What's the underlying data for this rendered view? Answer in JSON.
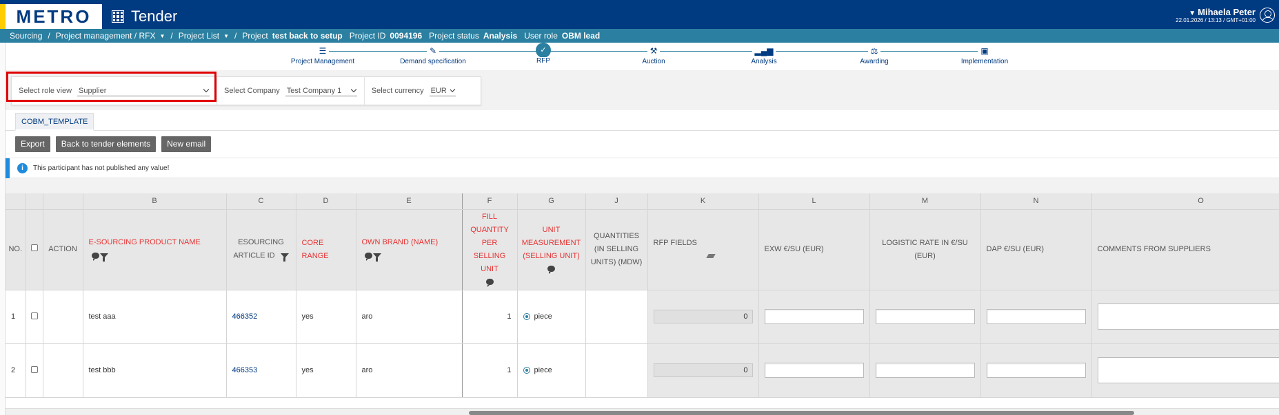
{
  "header": {
    "logo": "METRO",
    "app_title": "Tender",
    "user_name": "Mihaela Peter",
    "user_datetime": "22.01.2026 / 13:13 / GMT+01:00"
  },
  "breadcrumb": {
    "sourcing": "Sourcing",
    "project_management": "Project management / RFX",
    "project_list": "Project List",
    "project_label": "Project",
    "project_name": "test back to setup",
    "project_id_label": "Project ID",
    "project_id": "0094196",
    "status_label": "Project status",
    "status": "Analysis",
    "role_label": "User role",
    "role": "OBM lead"
  },
  "stepper": {
    "steps": [
      {
        "label": "Project Management",
        "icon": "list-icon"
      },
      {
        "label": "Demand specification",
        "icon": "pen-icon"
      },
      {
        "label": "RFP",
        "icon": "rfp-icon",
        "active": true
      },
      {
        "label": "Auction",
        "icon": "gavel-icon"
      },
      {
        "label": "Analysis",
        "icon": "bar-chart-icon"
      },
      {
        "label": "Awarding",
        "icon": "award-icon"
      },
      {
        "label": "Implementation",
        "icon": "chart-box-icon"
      }
    ]
  },
  "filters": {
    "role_view_label": "Select role view",
    "role_view_value": "Supplier",
    "company_label": "Select Company",
    "company_value": "Test Company 1",
    "currency_label": "Select currency",
    "currency_value": "EUR"
  },
  "tab": {
    "label": "COBM_TEMPLATE"
  },
  "buttons": {
    "export": "Export",
    "back": "Back to tender elements",
    "new_email": "New email"
  },
  "info": {
    "message": "This participant has not published any value!"
  },
  "table": {
    "letters": [
      "",
      "",
      "",
      "B",
      "C",
      "D",
      "E",
      "F",
      "G",
      "J",
      "K",
      "L",
      "M",
      "N",
      "O"
    ],
    "headers": {
      "no": "NO.",
      "action": "ACTION",
      "product_name": "E-SOURCING PRODUCT NAME",
      "article_id": "ESOURCING ARTICLE ID",
      "core_range": "CORE RANGE",
      "own_brand": "OWN BRAND (NAME)",
      "fill_qty": "FILL QUANTITY PER SELLING UNIT",
      "unit_measure": "UNIT MEASUREMENT (SELLING UNIT)",
      "quantities": "QUANTITIES (IN SELLING UNITS) (MDW)",
      "rfp_fields": "RFP FIELDS",
      "exw": "EXW €/SU (EUR)",
      "logistic": "LOGISTIC RATE IN €/SU (EUR)",
      "dap": "DAP €/SU (EUR)",
      "comments": "COMMENTS FROM SUPPLIERS"
    },
    "rows": [
      {
        "no": "1",
        "name": "test aaa",
        "article": "466352",
        "core": "yes",
        "brand": "aro",
        "fill": "1",
        "unit": "piece",
        "rfp": "0"
      },
      {
        "no": "2",
        "name": "test bbb",
        "article": "466353",
        "core": "yes",
        "brand": "aro",
        "fill": "1",
        "unit": "piece",
        "rfp": "0"
      }
    ]
  },
  "colors": {
    "header_bg": "#003a80",
    "crumb_bg": "#2b7fa0",
    "red_label": "#e63232",
    "highlight_box": "#e10000",
    "info_blue": "#1f8bdc"
  }
}
